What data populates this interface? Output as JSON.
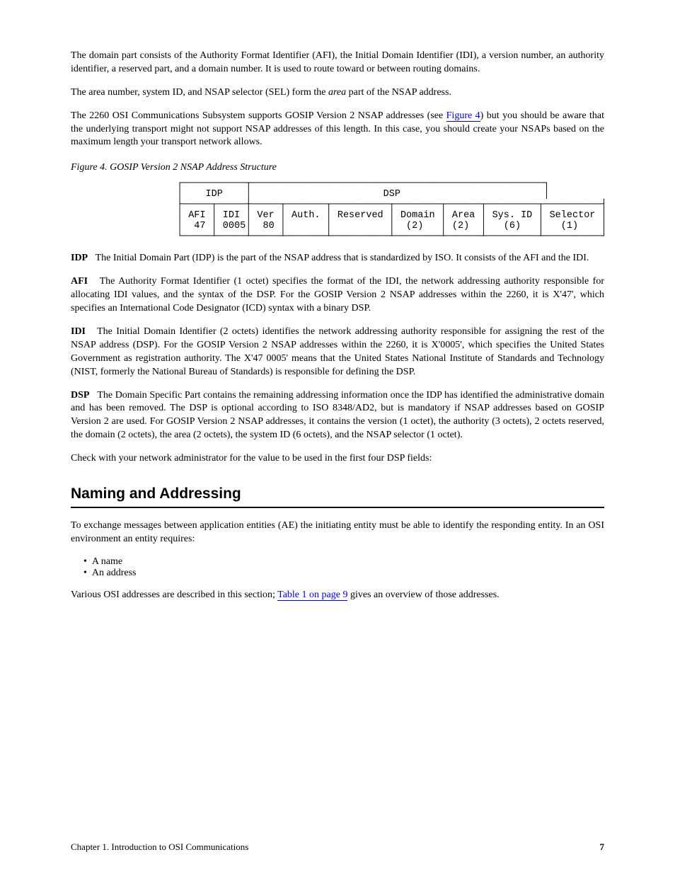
{
  "intro": {
    "p1": "The domain part consists of the Authority Format Identifier (AFI), the Initial Domain Identifier (IDI), a version number, an authority identifier, a reserved part, and a domain number. It is used to route toward or between routing domains.",
    "p2_a": "The area number, system ID, and NSAP selector (SEL) form the ",
    "p2_b": " part of the NSAP address.",
    "p2_emph": "area",
    "p3_a": "The 2260 OSI Communications Subsystem supports GOSIP Version 2 NSAP addresses (see ",
    "p3_link": "Figure 4",
    "p3_b": ") but you should be aware that the underlying transport might not support NSAP addresses of this length. In this case, you should create your NSAPs based on the maximum length your transport network allows."
  },
  "figure": {
    "caption": "Figure 4. GOSIP Version 2 NSAP Address Structure"
  },
  "diagram_rows": {
    "top": "┌───────────┬───────────────────────────────────────────────────┐",
    "r1": "│    IDP    │                       DSP                         │",
    "mid": "├─────┬─────┼─────┬───────┬──────────┬────────┬──────┬─────────┬──────────┤",
    "r2a": "│ AFI │ IDI │ Ver │ Auth. │ Reserved │ Domain │ Area │ Sys. ID │ Selector │",
    "r2b": "│  47 │ 0005│  80 │       │          │  (2)   │ (2)  │   (6)   │   (1)    │",
    "bot": "└─────┴─────┴─────┴───────┴──────────┴────────┴──────┴─────────┴──────────┘"
  },
  "chart_data": {
    "type": "table",
    "title": "GOSIP Version 2 NSAP Address Structure",
    "groups": [
      {
        "name": "IDP",
        "fields": [
          {
            "label": "AFI",
            "value": "47"
          },
          {
            "label": "IDI",
            "value": "0005"
          }
        ]
      },
      {
        "name": "DSP",
        "fields": [
          {
            "label": "Ver",
            "value": "80"
          },
          {
            "label": "Auth.",
            "value": ""
          },
          {
            "label": "Reserved",
            "value": ""
          },
          {
            "label": "Domain",
            "octets": 2
          },
          {
            "label": "Area",
            "octets": 2
          },
          {
            "label": "Sys. ID",
            "octets": 6
          },
          {
            "label": "Selector",
            "octets": 1
          }
        ]
      }
    ]
  },
  "idp": {
    "heading": "IDP",
    "text": "The Initial Domain Part (IDP) is the part of the NSAP address that is standardized by ISO. It consists of the AFI and the IDI."
  },
  "afi": {
    "heading": "AFI",
    "text": "The Authority Format Identifier (1 octet) specifies the format of the IDI, the network addressing authority responsible for allocating IDI values, and the syntax of the DSP. For the GOSIP Version 2 NSAP addresses within the 2260, it is X'47', which specifies an International Code Designator (ICD) syntax with a binary DSP."
  },
  "idi": {
    "heading": "IDI",
    "text": "The Initial Domain Identifier (2 octets) identifies the network addressing authority responsible for assigning the rest of the NSAP address (DSP). For the GOSIP Version 2 NSAP addresses within the 2260, it is X'0005', which specifies the United States Government as registration authority. The X'47 0005' means that the United States National Institute of Standards and Technology (NIST, formerly the National Bureau of Standards) is responsible for defining the DSP."
  },
  "dsp": {
    "heading": "DSP",
    "p1": "The Domain Specific Part contains the remaining addressing information once the IDP has identified the administrative domain and has been removed. The DSP is optional according to ISO 8348/AD2, but is mandatory if NSAP addresses based on GOSIP Version 2 are used. For GOSIP Version 2 NSAP addresses, it contains the version (1 octet), the authority (3 octets), 2 octets reserved, the domain (2 octets), the area (2 octets), the system ID (6 octets), and the NSAP selector (1 octet).",
    "p2": "Check with your network administrator for the value to be used in the first four DSP fields:"
  },
  "naming": {
    "title": "Naming and Addressing",
    "p1": "To exchange messages between application entities (AE) the initiating entity must be able to identify the responding entity. In an OSI environment an entity requires:",
    "bullets": [
      "A name",
      "An address"
    ],
    "p2_a": "Various OSI addresses are described in this section; ",
    "p2_link": "Table 1 on page 9",
    "p2_b": " gives an overview of those addresses."
  },
  "footer": {
    "left": "Chapter 1. Introduction to OSI Communications",
    "right": "7"
  }
}
